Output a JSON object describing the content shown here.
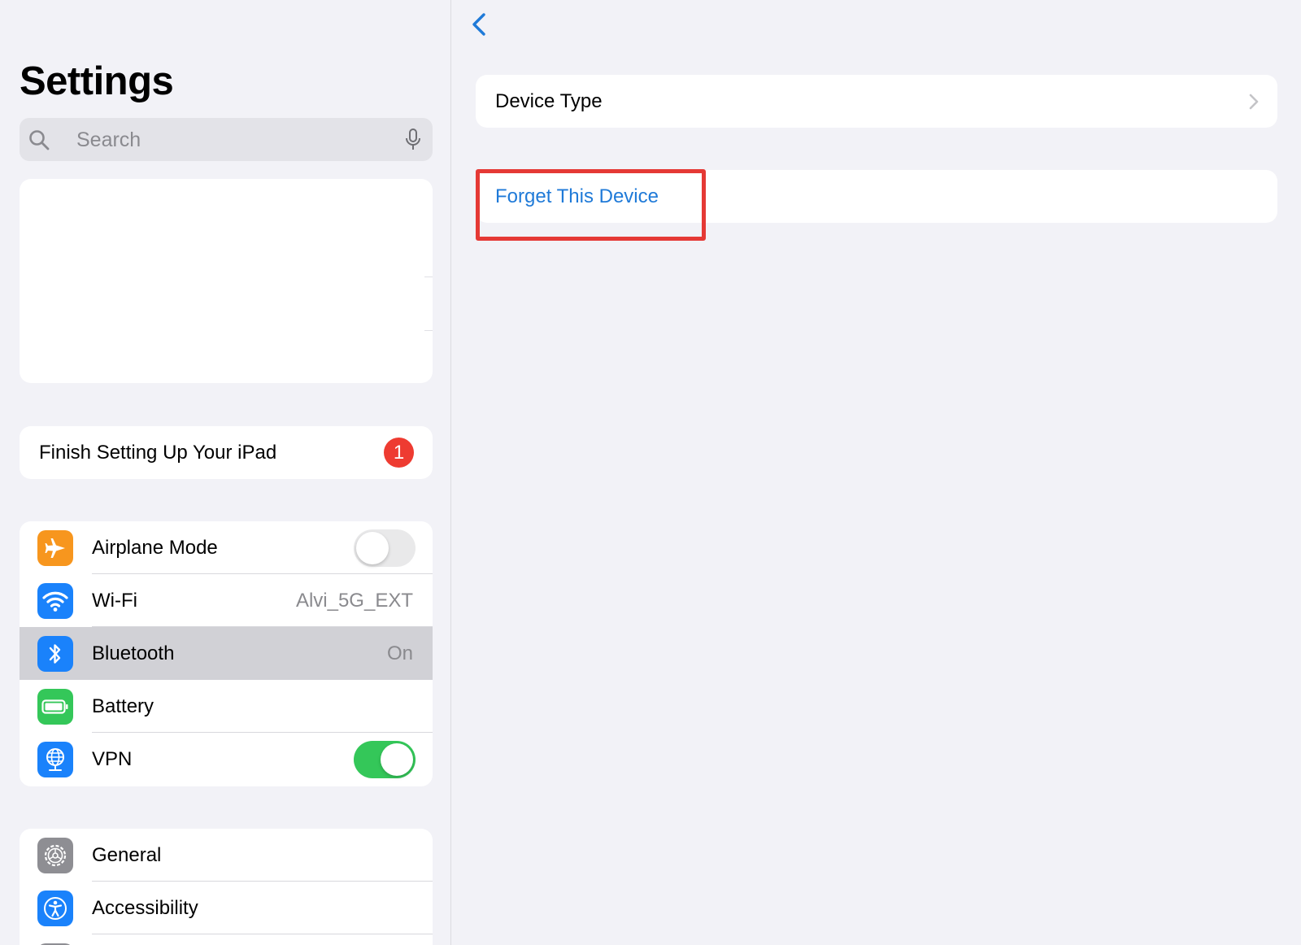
{
  "sidebar": {
    "title": "Settings",
    "search": {
      "placeholder": "Search"
    },
    "setup": {
      "label": "Finish Setting Up Your iPad",
      "badge": "1"
    },
    "group1": [
      {
        "label": "Airplane Mode",
        "icon": "airplane-icon",
        "color": "#f7961e",
        "toggle": "off"
      },
      {
        "label": "Wi-Fi",
        "icon": "wifi-icon",
        "color": "#1a82fb",
        "value": "Alvi_5G_EXT"
      },
      {
        "label": "Bluetooth",
        "icon": "bluetooth-icon",
        "color": "#1a82fb",
        "value": "On",
        "selected": true
      },
      {
        "label": "Battery",
        "icon": "battery-icon",
        "color": "#34c759"
      },
      {
        "label": "VPN",
        "icon": "vpn-globe-icon",
        "color": "#1a82fb",
        "toggle": "on"
      }
    ],
    "group2": [
      {
        "label": "General",
        "icon": "gear-icon",
        "color": "#8e8e93"
      },
      {
        "label": "Accessibility",
        "icon": "accessibility-icon",
        "color": "#1a82fb"
      },
      {
        "label": "",
        "icon": "next-item-icon",
        "color": "#8e8e93"
      }
    ]
  },
  "detail": {
    "back_icon": "chevron-left-icon",
    "device_type": "Device Type",
    "forget": "Forget This Device"
  },
  "colors": {
    "accent": "#1f7ad8",
    "highlight": "#e53935",
    "toggle_on": "#34c759",
    "badge": "#ee3b31"
  }
}
